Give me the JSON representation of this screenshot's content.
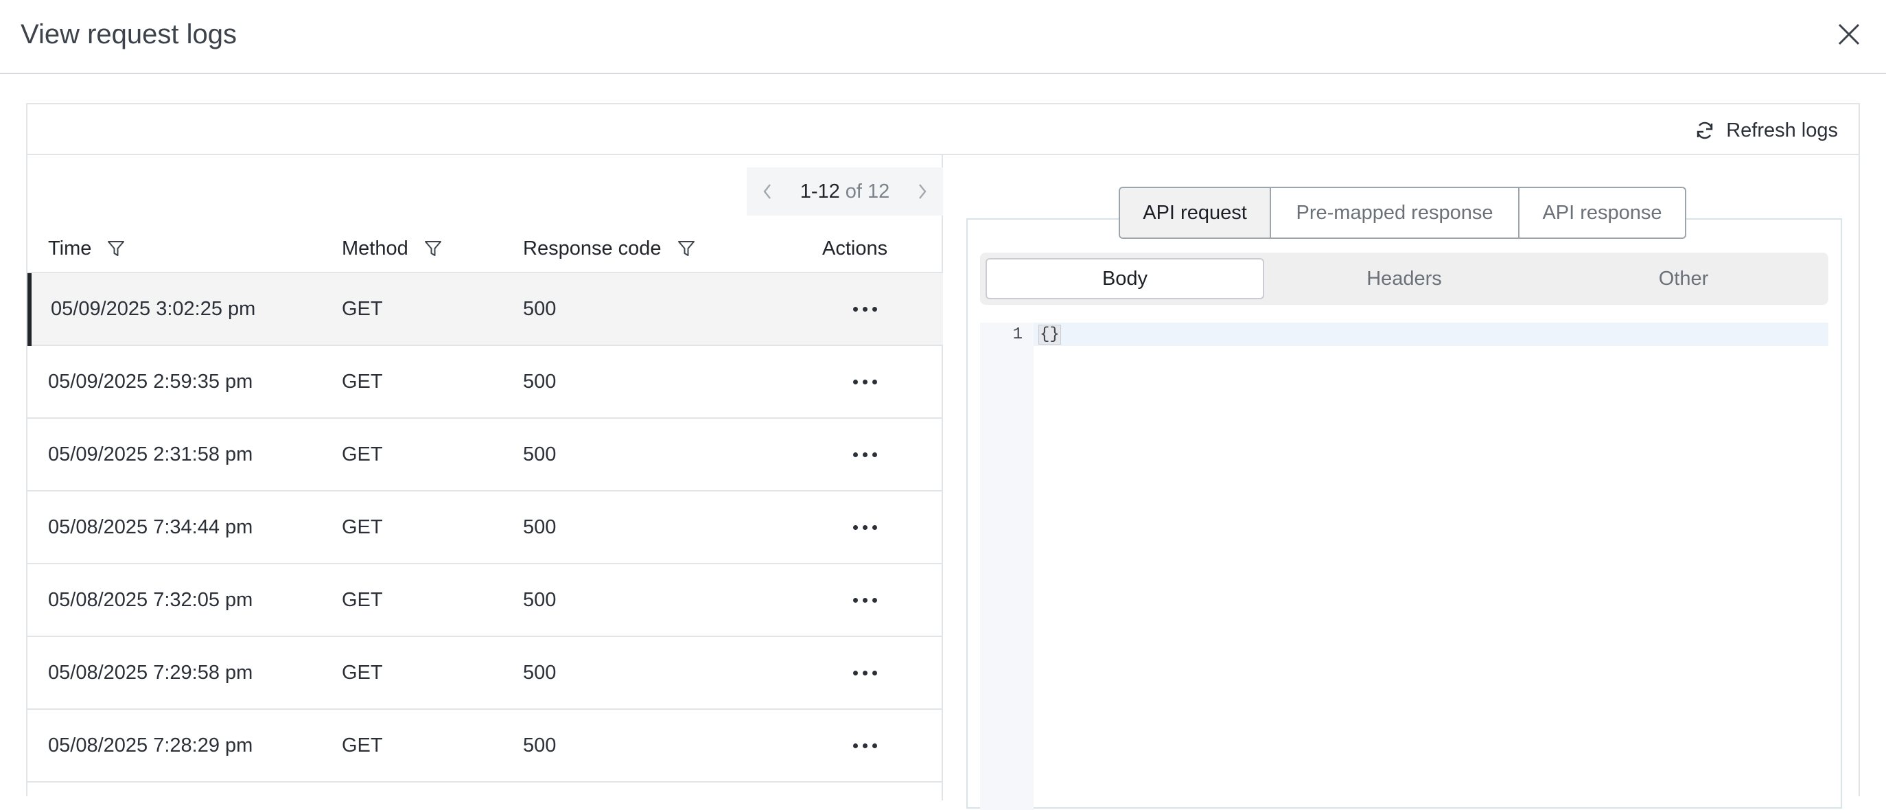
{
  "modal": {
    "title": "View request logs"
  },
  "toolbar": {
    "refresh_label": "Refresh logs"
  },
  "pager": {
    "range": "1-12",
    "of_text": "of 12"
  },
  "table": {
    "headers": {
      "time": "Time",
      "method": "Method",
      "code": "Response code",
      "actions": "Actions"
    },
    "rows": [
      {
        "time": "05/09/2025 3:02:25 pm",
        "method": "GET",
        "code": "500"
      },
      {
        "time": "05/09/2025 2:59:35 pm",
        "method": "GET",
        "code": "500"
      },
      {
        "time": "05/09/2025 2:31:58 pm",
        "method": "GET",
        "code": "500"
      },
      {
        "time": "05/08/2025 7:34:44 pm",
        "method": "GET",
        "code": "500"
      },
      {
        "time": "05/08/2025 7:32:05 pm",
        "method": "GET",
        "code": "500"
      },
      {
        "time": "05/08/2025 7:29:58 pm",
        "method": "GET",
        "code": "500"
      },
      {
        "time": "05/08/2025 7:28:29 pm",
        "method": "GET",
        "code": "500"
      }
    ]
  },
  "detail": {
    "tabs": [
      "API request",
      "Pre-mapped response",
      "API response"
    ],
    "subtabs": [
      "Body",
      "Headers",
      "Other"
    ],
    "editor": {
      "line_number": "1",
      "content": "{}"
    }
  }
}
